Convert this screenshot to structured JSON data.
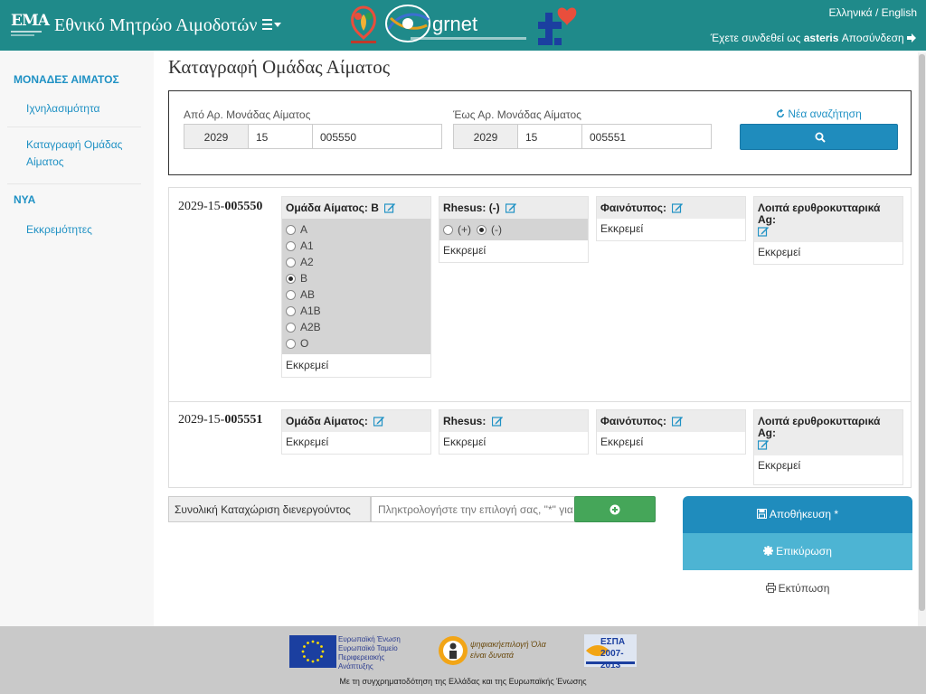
{
  "header": {
    "logo_text": "EMA",
    "title": "Εθνικό Μητρώο Αιμοδοτών",
    "partners": {
      "seda": "Ε.Κ.Ε.Α.",
      "grnet": "grnet"
    },
    "lang_el": "Ελληνικά",
    "lang_sep": " / ",
    "lang_en": "English",
    "logged_prefix": "Έχετε συνδεθεί ως ",
    "username": "asteris",
    "logout": "Αποσύνδεση"
  },
  "sidebar": {
    "section1": "ΜΟΝΑΔΕΣ ΑΙΜΑΤΟΣ",
    "link_trace": "Ιχνηλασιμότητα",
    "link_blood_group": "Καταγραφή Ομάδας Αίματος",
    "section2": "ΝΥΑ",
    "link_pending": "Εκκρεμότητες"
  },
  "page": {
    "title": "Καταγραφή Ομάδας Αίματος"
  },
  "search": {
    "from_label": "Από Αρ. Μονάδας Αίματος",
    "to_label": "Έως Αρ. Μονάδας Αίματος",
    "from": {
      "year": "2029",
      "center": "15",
      "number": "005550"
    },
    "to": {
      "year": "2029",
      "center": "15",
      "number": "005551"
    },
    "new_search": "Νέα αναζήτηση"
  },
  "units": [
    {
      "id_prefix": "2029-15-",
      "id_number": "005550",
      "blood_group_label": "Ομάδα Αίματος:",
      "blood_group_value": "B",
      "blood_options": [
        "A",
        "A1",
        "A2",
        "B",
        "AB",
        "A1B",
        "A2B",
        "O"
      ],
      "blood_selected": "B",
      "rhesus_label": "Rhesus:",
      "rhesus_value": "(-)",
      "rhesus_pos": "(+)",
      "rhesus_neg": "(-)",
      "phenotype_label": "Φαινότυπος:",
      "other_ag_label": "Λοιπά ερυθροκυτταρικά Ag:",
      "pending": "Εκκρεμεί"
    },
    {
      "id_prefix": "2029-15-",
      "id_number": "005551",
      "blood_group_label": "Ομάδα Αίματος:",
      "rhesus_label": "Rhesus:",
      "phenotype_label": "Φαινότυπος:",
      "other_ag_label": "Λοιπά ερυθροκυτταρικά Ag:",
      "pending": "Εκκρεμεί"
    }
  ],
  "bulk": {
    "label": "Συνολική Καταχώριση διενεργούντος",
    "placeholder": "Πληκτρολογήστε την επιλογή σας, \"*\" για"
  },
  "actions": {
    "save": "Αποθήκευση *",
    "validate": "Επικύρωση",
    "print": "Εκτύπωση"
  },
  "footer": {
    "eu_text": "Ευρωπαϊκή Ένωση Ευρωπαϊκό Ταμείο Περιφερειακής Ανάπτυξης",
    "digital_text": "ψηφιακήεπιλογή Όλα είναι δυνατά",
    "espa_text": "ΕΣΠΑ 2007-2013",
    "credit": "Με τη συγχρηματοδότηση της Ελλάδας και της Ευρωπαϊκής Ένωσης"
  },
  "colors": {
    "header": "#1f8a8a",
    "link": "#1f91c4",
    "primary": "#1f8cbd",
    "success": "#45a659",
    "info": "#4db4d3"
  }
}
